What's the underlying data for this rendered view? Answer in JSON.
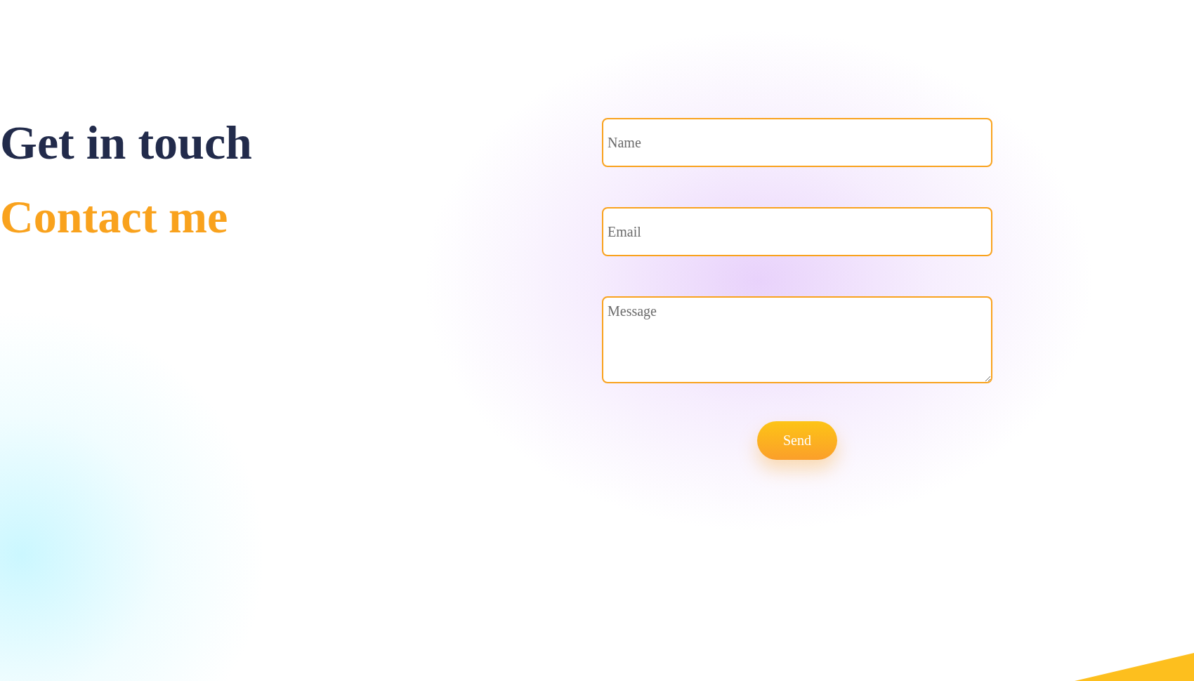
{
  "heading": "Get in touch",
  "subheading": "Contact me",
  "form": {
    "fields": [
      {
        "kind": "input",
        "placeholder": "Name"
      },
      {
        "kind": "input",
        "placeholder": "Email"
      },
      {
        "kind": "textarea",
        "placeholder": "Message"
      }
    ],
    "submit": "Send"
  }
}
